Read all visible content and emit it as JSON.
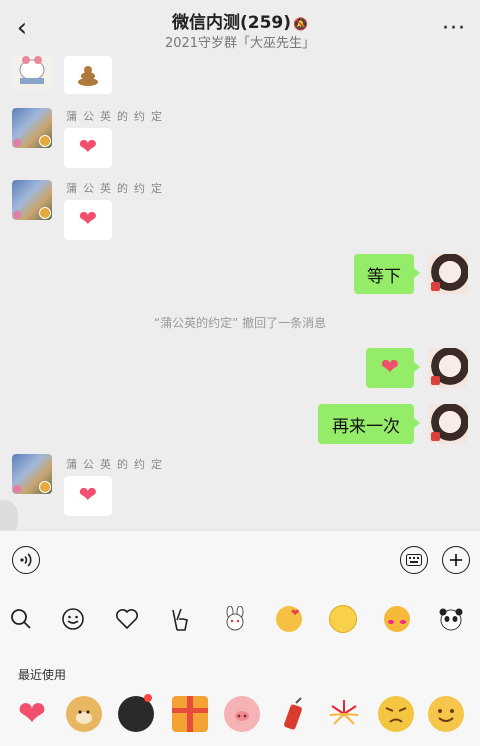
{
  "header": {
    "back_icon": "back-chevron-icon",
    "title": "微信内测(259)",
    "subtitle": "2021守岁群「大巫先生」",
    "mute_icon": "bell-muted-icon",
    "more_icon": "more-dots-icon"
  },
  "messages": [
    {
      "side": "left",
      "type": "emoji",
      "emoji": "poop"
    },
    {
      "side": "left",
      "sender": "蒲公英的约定",
      "type": "emoji",
      "emoji": "heart"
    },
    {
      "side": "left",
      "sender": "蒲公英的约定",
      "type": "emoji",
      "emoji": "heart"
    },
    {
      "side": "right",
      "type": "text",
      "text": "等下"
    },
    {
      "side": "system",
      "type": "recall",
      "text": "“蒲公英的约定” 撤回了一条消息"
    },
    {
      "side": "right",
      "type": "emoji",
      "emoji": "heart"
    },
    {
      "side": "right",
      "type": "text",
      "text": "再来一次"
    },
    {
      "side": "left",
      "sender": "蒲公英的约定",
      "type": "emoji",
      "emoji": "heart"
    }
  ],
  "input": {
    "voice_icon": "voice-icon",
    "keyboard_icon": "keyboard-icon",
    "plus_icon": "plus-icon",
    "value": ""
  },
  "emoji_tabs": [
    "search-icon",
    "smiley-icon",
    "heart-outline-icon",
    "victory-hand-icon",
    "bunny-sticker-icon",
    "kiss-face-icon",
    "blush-face-icon",
    "shy-face-icon",
    "panda-sticker-icon"
  ],
  "recent": {
    "label": "最近使用",
    "items": [
      "heart",
      "doge",
      "bomb",
      "gift",
      "pig",
      "firecracker",
      "fireworks",
      "angry-face",
      "smile-face"
    ]
  }
}
